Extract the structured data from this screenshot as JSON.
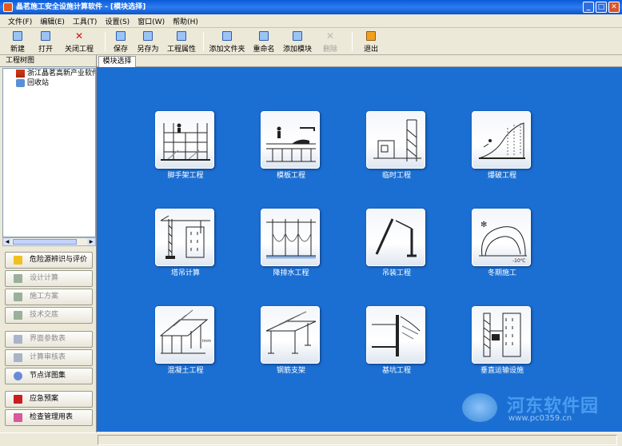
{
  "window": {
    "title": "晶茗施工安全设施计算软件 - [模块选择]"
  },
  "menubar": [
    "文件(F)",
    "编辑(E)",
    "工具(T)",
    "设置(S)",
    "窗口(W)",
    "帮助(H)"
  ],
  "toolbar": {
    "new": "新建",
    "open": "打开",
    "close_project": "关闭工程",
    "save": "保存",
    "save_as": "另存为",
    "project_props": "工程属性",
    "add_folder": "添加文件夹",
    "rename": "重命名",
    "add_module": "添加模块",
    "delete": "删除",
    "exit": "退出"
  },
  "left_panel": {
    "title": "工程树图",
    "tree": [
      {
        "label": "浙江晶茗高新产业软件",
        "icon": "home-icon"
      },
      {
        "label": "回收站",
        "icon": "recycle-bin-icon"
      }
    ],
    "buttons": [
      {
        "label": "危险源辨识与评价",
        "enabled": true
      },
      {
        "label": "设计计算",
        "enabled": false
      },
      {
        "label": "施工方案",
        "enabled": false
      },
      {
        "label": "技术交底",
        "enabled": false
      },
      {
        "label": "界面参数表",
        "enabled": false
      },
      {
        "label": "计算审核表",
        "enabled": false
      },
      {
        "label": "节点详图集",
        "enabled": true
      },
      {
        "label": "应急预案",
        "enabled": true
      },
      {
        "label": "检查管理用表",
        "enabled": true
      }
    ]
  },
  "tabs": [
    "模块选择"
  ],
  "modules": [
    {
      "label": "脚手架工程",
      "icon": "scaffold-icon"
    },
    {
      "label": "模板工程",
      "icon": "formwork-icon"
    },
    {
      "label": "临时工程",
      "icon": "temporary-works-icon"
    },
    {
      "label": "爆破工程",
      "icon": "blasting-icon"
    },
    {
      "label": "塔吊计算",
      "icon": "tower-crane-icon"
    },
    {
      "label": "降排水工程",
      "icon": "dewatering-icon"
    },
    {
      "label": "吊装工程",
      "icon": "hoisting-icon"
    },
    {
      "label": "冬期施工",
      "icon": "winter-construction-icon"
    },
    {
      "label": "混凝土工程",
      "icon": "concrete-icon"
    },
    {
      "label": "钢筋支架",
      "icon": "rebar-support-icon"
    },
    {
      "label": "基坑工程",
      "icon": "foundation-pit-icon"
    },
    {
      "label": "垂直运输设施",
      "icon": "vertical-transport-icon"
    }
  ],
  "watermark": {
    "text": "河东软件园",
    "url": "www.pc0359.cn"
  }
}
